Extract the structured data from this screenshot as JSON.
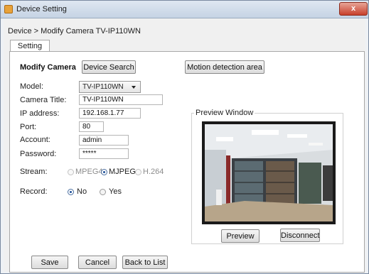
{
  "window": {
    "title": "Device Setting",
    "close_glyph": "x"
  },
  "breadcrumb": "Device > Modify Camera TV-IP110WN",
  "tabs": {
    "setting": "Setting"
  },
  "header": {
    "section_title": "Modify Camera",
    "device_search": "Device Search",
    "motion_detection": "Motion detection area"
  },
  "form": {
    "model_label": "Model:",
    "model_value": "TV-IP110WN",
    "camera_title_label": "Camera Title:",
    "camera_title_value": "TV-IP110WN",
    "ip_label": "IP address:",
    "ip_value": "192.168.1.77",
    "port_label": "Port:",
    "port_value": "80",
    "account_label": "Account:",
    "account_value": "admin",
    "password_label": "Password:",
    "password_value": "*****",
    "stream_label": "Stream:",
    "stream_options": [
      "MPEG4",
      "MJPEG",
      "H.264"
    ],
    "stream_selected": "MJPEG",
    "record_label": "Record:",
    "record_options": [
      "No",
      "Yes"
    ],
    "record_selected": "No"
  },
  "preview": {
    "group_title": "Preview Window",
    "preview_button": "Preview",
    "disconnect_button": "Disconnect"
  },
  "footer": {
    "save": "Save",
    "cancel": "Cancel",
    "back": "Back to List"
  },
  "colors": {
    "titlebar": "#c5d3e4",
    "close": "#c7402b",
    "radio_on": "#1c4e98"
  }
}
